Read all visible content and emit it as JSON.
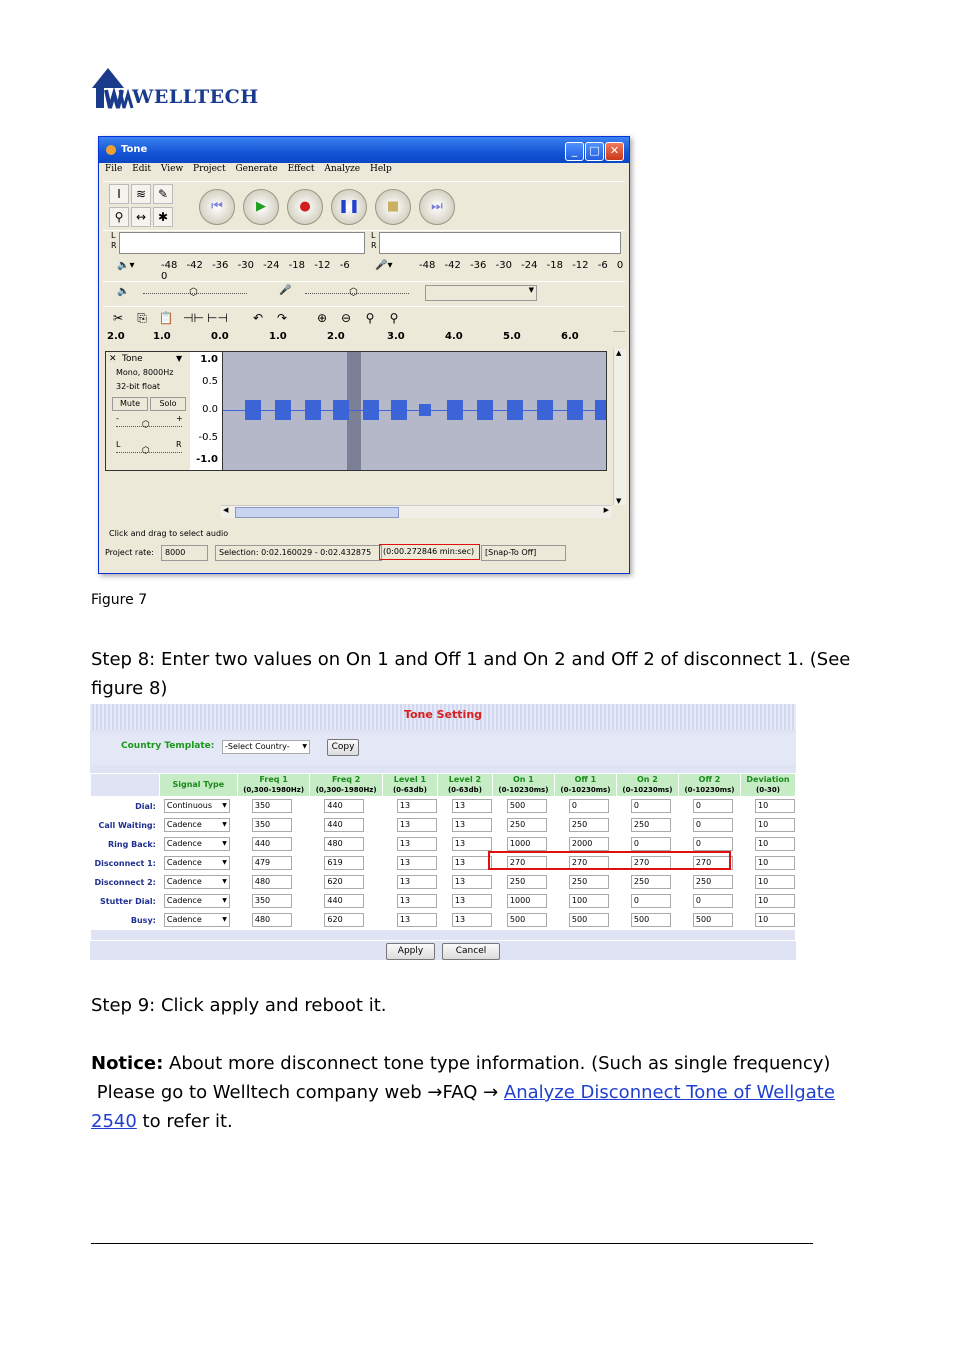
{
  "logo": {
    "text": "WELLTECH"
  },
  "figure7": {
    "window_title": "Tone",
    "menu": [
      "File",
      "Edit",
      "View",
      "Project",
      "Generate",
      "Effect",
      "Analyze",
      "Help"
    ],
    "meter_scale": [
      "-48",
      "-42",
      "-36",
      "-30",
      "-24",
      "-18",
      "-12",
      "-6",
      "0"
    ],
    "meter_channels": [
      "L",
      "R"
    ],
    "timeline": [
      "2.0",
      "1.0",
      "0.0",
      "1.0",
      "2.0",
      "3.0",
      "4.0",
      "5.0",
      "6.0"
    ],
    "track": {
      "name": "Tone",
      "format": "Mono, 8000Hz",
      "bits": "32-bit float",
      "mute": "Mute",
      "solo": "Solo",
      "pan_left": "L",
      "pan_right": "R",
      "gain_minus": "-",
      "gain_plus": "+"
    },
    "vscale": [
      "1.0",
      "0.5",
      "0.0",
      "-0.5",
      "-1.0"
    ],
    "status_hint": "Click and drag to select audio",
    "project_rate_label": "Project rate:",
    "project_rate": "8000",
    "selection": "Selection: 0:02.160029 - 0:02.432875",
    "selection_length": "(0:00.272846 min:sec)",
    "snap": "[Snap-To Off]",
    "caption": "Figure 7"
  },
  "step8": "Step 8: Enter two values on On 1 and Off 1 and On 2 and Off 2 of disconnect 1. (See figure 8)",
  "tone_setting": {
    "title": "Tone Setting",
    "country_label": "Country Template:",
    "country_select": "-Select Country-",
    "copy": "Copy",
    "headers": [
      {
        "name": "Signal Type",
        "range": ""
      },
      {
        "name": "Freq 1",
        "range": "(0,300-1980Hz)"
      },
      {
        "name": "Freq 2",
        "range": "(0,300-1980Hz)"
      },
      {
        "name": "Level 1",
        "range": "(0-63db)"
      },
      {
        "name": "Level 2",
        "range": "(0-63db)"
      },
      {
        "name": "On 1",
        "range": "(0-10230ms)"
      },
      {
        "name": "Off 1",
        "range": "(0-10230ms)"
      },
      {
        "name": "On 2",
        "range": "(0-10230ms)"
      },
      {
        "name": "Off 2",
        "range": "(0-10230ms)"
      },
      {
        "name": "Deviation",
        "range": "(0-30)"
      }
    ],
    "rows": [
      {
        "label": "Dial:",
        "type": "Continuous",
        "v": [
          "350",
          "440",
          "13",
          "13",
          "500",
          "0",
          "0",
          "0",
          "10"
        ]
      },
      {
        "label": "Call Waiting:",
        "type": "Cadence",
        "v": [
          "350",
          "440",
          "13",
          "13",
          "250",
          "250",
          "250",
          "0",
          "10"
        ]
      },
      {
        "label": "Ring Back:",
        "type": "Cadence",
        "v": [
          "440",
          "480",
          "13",
          "13",
          "1000",
          "2000",
          "0",
          "0",
          "10"
        ]
      },
      {
        "label": "Disconnect 1:",
        "type": "Cadence",
        "v": [
          "479",
          "619",
          "13",
          "13",
          "270",
          "270",
          "270",
          "270",
          "10"
        ]
      },
      {
        "label": "Disconnect 2:",
        "type": "Cadence",
        "v": [
          "480",
          "620",
          "13",
          "13",
          "250",
          "250",
          "250",
          "250",
          "10"
        ]
      },
      {
        "label": "Stutter Dial:",
        "type": "Cadence",
        "v": [
          "350",
          "440",
          "13",
          "13",
          "1000",
          "100",
          "0",
          "0",
          "10"
        ]
      },
      {
        "label": "Busy:",
        "type": "Cadence",
        "v": [
          "480",
          "620",
          "13",
          "13",
          "500",
          "500",
          "500",
          "500",
          "10"
        ]
      }
    ],
    "apply": "Apply",
    "cancel": "Cancel"
  },
  "step9": "Step 9: Click apply and reboot it.",
  "notice": {
    "label": "Notice:",
    "text": " About more disconnect tone type information. (Such as single frequency)",
    "line2_prefix": " Please go to Welltech company web →FAQ → ",
    "link": "Analyze Disconnect Tone of Wellgate 2540",
    "line2_suffix": " to refer it."
  }
}
